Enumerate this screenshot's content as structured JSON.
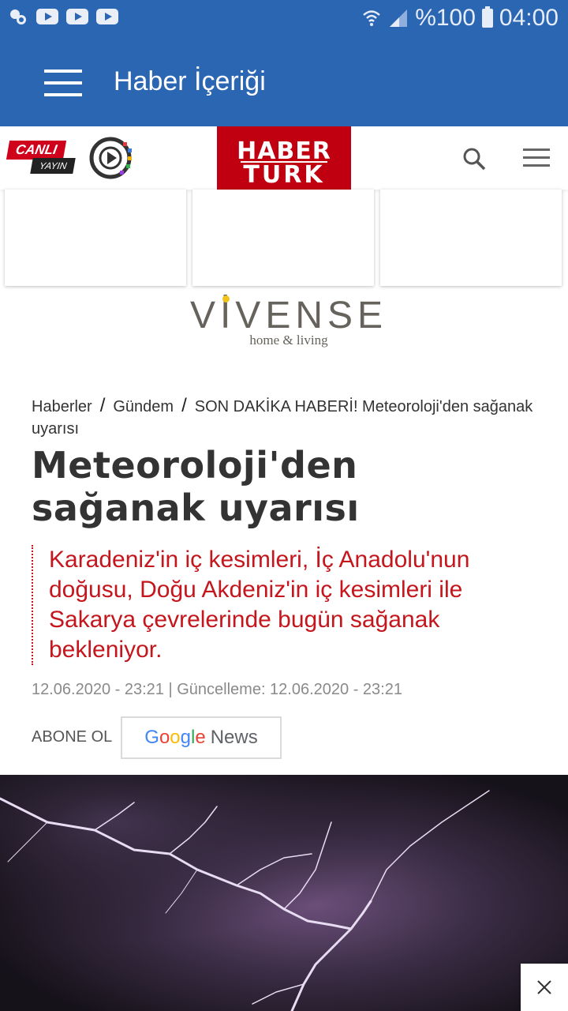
{
  "status_bar": {
    "battery_text": "%100",
    "time": "04:00"
  },
  "app_bar": {
    "title": "Haber İçeriği"
  },
  "site_header": {
    "live_top": "CANLI",
    "live_bottom": "YAYIN",
    "logo_line1": "HABER",
    "logo_line2": "TURK"
  },
  "ad": {
    "brand": "VİVENSE",
    "tagline": "home & living"
  },
  "breadcrumb": {
    "items": [
      "Haberler",
      "Gündem",
      "SON DAKİKA HABERİ! Meteoroloji'den sağanak uyarısı"
    ]
  },
  "article": {
    "headline": "Meteoroloji'den sağanak uyarısı",
    "spot": "Karadeniz'in iç kesimleri, İç Anadolu'nun doğusu, Doğu Akdeniz'in iç kesimleri ile Sakarya çevrelerinde bugün sağanak bekleniyor.",
    "dates": "12.06.2020 - 23:21 | Güncelleme: 12.06.2020 - 23:21"
  },
  "subscribe": {
    "label": "ABONE OL",
    "google": [
      "G",
      "o",
      "o",
      "g",
      "l",
      "e"
    ],
    "news": "News"
  },
  "colors": {
    "app_blue": "#2b66b3",
    "brand_red": "#c00010",
    "spot_red": "#c4161c"
  }
}
